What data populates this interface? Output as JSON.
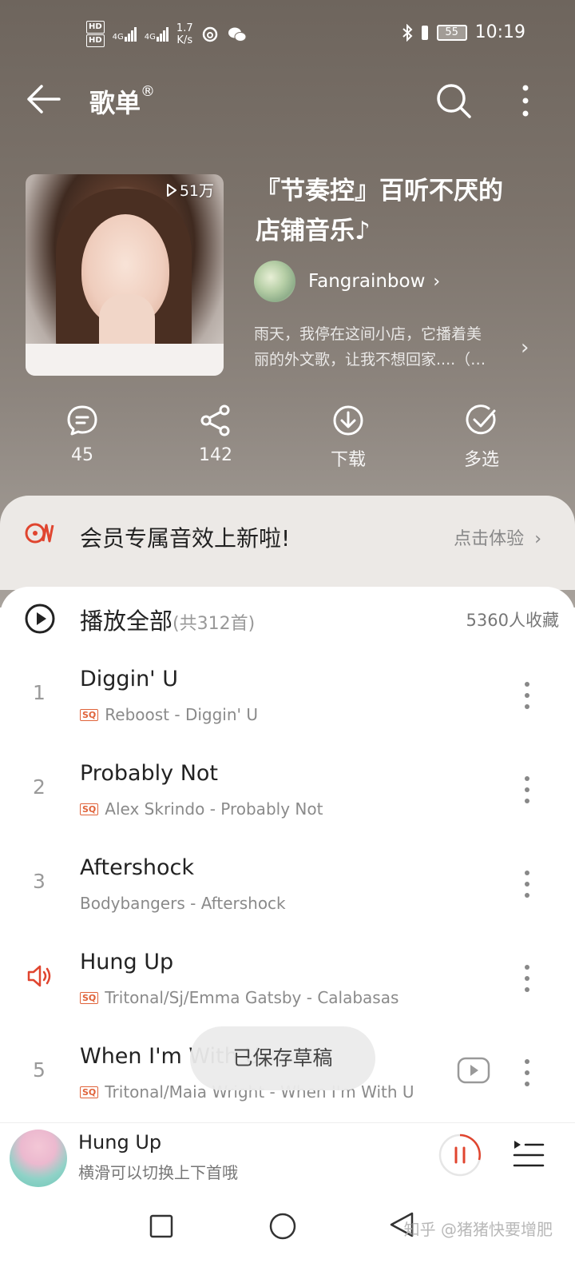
{
  "status_bar": {
    "hd1": "HD",
    "hd2": "HD",
    "sig1": "4G",
    "sig2": "4G",
    "speed_value": "1.7",
    "speed_unit": "K/s",
    "battery": "55",
    "time": "10:19"
  },
  "nav": {
    "title": "歌单",
    "registered": "®"
  },
  "playlist": {
    "play_count": "51万",
    "title_line1": "『节奏控』百听不厌的",
    "title_line2": "店铺音乐♪",
    "creator": "Fangrainbow",
    "description_line1": "雨天，我停在这间小店，它播着美",
    "description_line2": "丽的外文歌，让我不想回家....（…"
  },
  "actions": [
    {
      "label": "45",
      "icon": "comment-icon"
    },
    {
      "label": "142",
      "icon": "share-icon"
    },
    {
      "label": "下载",
      "icon": "download-icon"
    },
    {
      "label": "多选",
      "icon": "multi-select-icon"
    }
  ],
  "member_banner": {
    "text": "会员专属音效上新啦!",
    "cta": "点击体验"
  },
  "play_all": {
    "label": "播放全部",
    "count": "(共312首)",
    "favorites": "5360人收藏"
  },
  "songs": [
    {
      "num": "1",
      "title": "Diggin' U",
      "artist": "Reboost - Diggin' U",
      "sq": true
    },
    {
      "num": "2",
      "title": "Probably Not",
      "artist": "Alex Skrindo - Probably Not",
      "sq": true
    },
    {
      "num": "3",
      "title": "Aftershock",
      "artist": "Bodybangers - Aftershock",
      "sq": false
    },
    {
      "num": "",
      "title": "Hung Up",
      "artist": "Tritonal/Sj/Emma Gatsby - Calabasas",
      "sq": true,
      "playing": true
    },
    {
      "num": "5",
      "title": "When I'm With U",
      "artist": "Tritonal/Maia Wright - When I'm With U",
      "sq": true,
      "mv": true
    }
  ],
  "sq_badge": "SQ",
  "toast": "已保存草稿",
  "mini_player": {
    "title": "Hung Up",
    "subtitle": "横滑可以切换上下首哦"
  },
  "watermark": "知乎 @猪猪快要增肥",
  "colors": {
    "accent": "#e0452f",
    "header_bg": "#7a7169"
  }
}
